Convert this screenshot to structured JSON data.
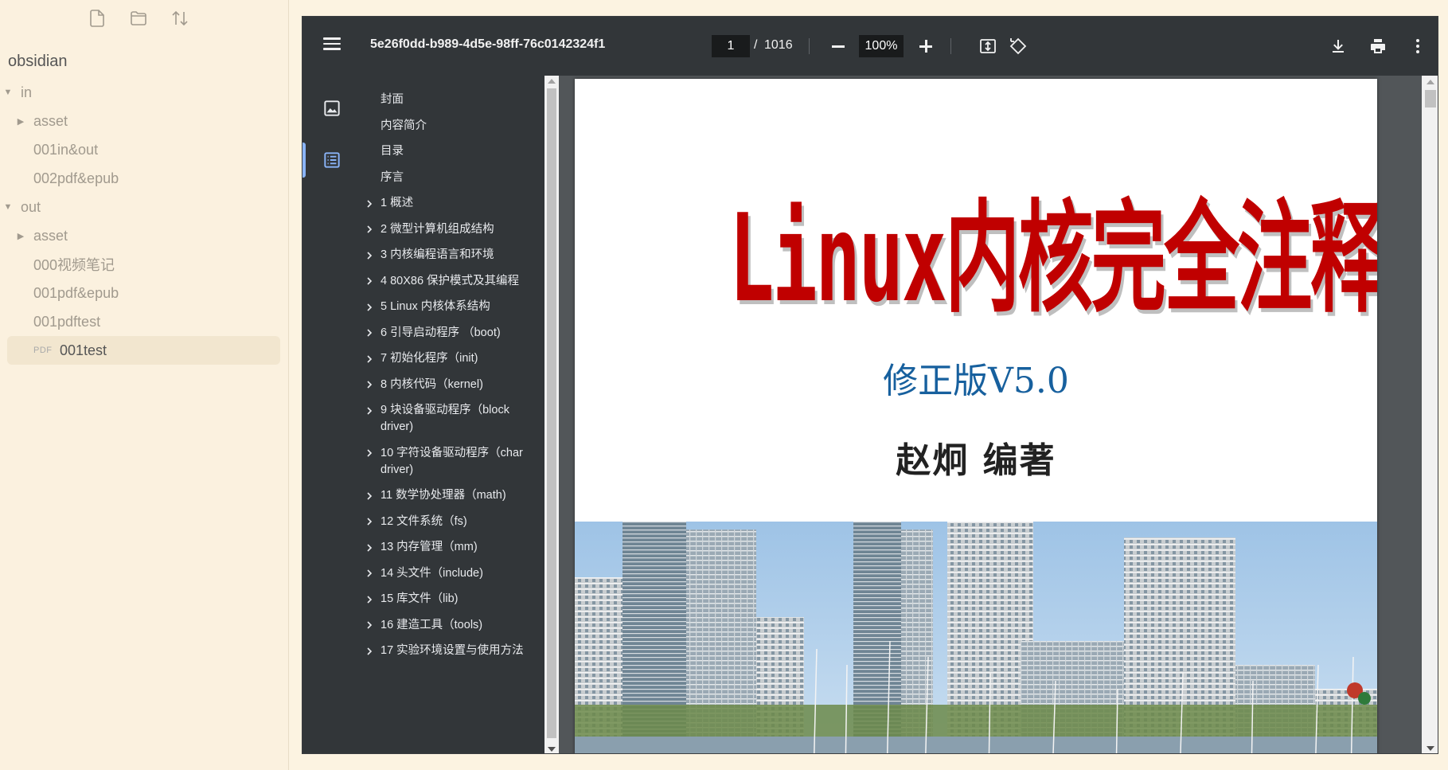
{
  "explorer": {
    "toolbar": [
      "new-note-icon",
      "new-folder-icon",
      "sort-icon"
    ],
    "vault_name": "obsidian",
    "tree": [
      {
        "label": "in",
        "level": 0,
        "type": "folder",
        "expanded": true
      },
      {
        "label": "asset",
        "level": 1,
        "type": "folder",
        "expanded": false
      },
      {
        "label": "001in&out",
        "level": 1,
        "type": "file"
      },
      {
        "label": "002pdf&epub",
        "level": 1,
        "type": "file"
      },
      {
        "label": "out",
        "level": 0,
        "type": "folder",
        "expanded": true
      },
      {
        "label": "asset",
        "level": 1,
        "type": "folder",
        "expanded": false
      },
      {
        "label": "000视频笔记",
        "level": 1,
        "type": "file"
      },
      {
        "label": "001pdf&epub",
        "level": 1,
        "type": "file"
      },
      {
        "label": "001pdftest",
        "level": 1,
        "type": "file"
      },
      {
        "label": "001test",
        "level": 1,
        "type": "pdf",
        "tag": "PDF",
        "selected": true
      }
    ]
  },
  "viewer": {
    "title": "5e26f0dd-b989-4d5e-98ff-76c0142324f1",
    "page_current": "1",
    "page_sep": "/",
    "page_total": "1016",
    "zoom": "100%",
    "outline": [
      {
        "label": "封面",
        "expandable": false
      },
      {
        "label": "内容简介",
        "expandable": false
      },
      {
        "label": "目录",
        "expandable": false
      },
      {
        "label": "序言",
        "expandable": false
      },
      {
        "label": "1 概述",
        "expandable": true
      },
      {
        "label": "2 微型计算机组成结构",
        "expandable": true
      },
      {
        "label": "3 内核编程语言和环境",
        "expandable": true
      },
      {
        "label": "4 80X86 保护模式及其编程",
        "expandable": true
      },
      {
        "label": "5 Linux 内核体系结构",
        "expandable": true
      },
      {
        "label": "6 引导启动程序 （boot)",
        "expandable": true
      },
      {
        "label": "7 初始化程序（init)",
        "expandable": true
      },
      {
        "label": "8 内核代码（kernel)",
        "expandable": true
      },
      {
        "label": "9 块设备驱动程序（block driver)",
        "expandable": true
      },
      {
        "label": "10 字符设备驱动程序（char driver)",
        "expandable": true
      },
      {
        "label": "11 数学协处理器（math)",
        "expandable": true
      },
      {
        "label": "12 文件系统（fs)",
        "expandable": true
      },
      {
        "label": "13 内存管理（mm)",
        "expandable": true
      },
      {
        "label": "14 头文件（include)",
        "expandable": true
      },
      {
        "label": "15 库文件（lib)",
        "expandable": true
      },
      {
        "label": "16 建造工具（tools)",
        "expandable": true
      },
      {
        "label": "17 实验环境设置与使用方法",
        "expandable": true
      }
    ],
    "page": {
      "title": "Linux内核完全注释",
      "edition": "修正版V5.0",
      "author": "赵炯 编著"
    }
  },
  "colors": {
    "explorer_bg": "#fbf1df",
    "toolbar_bg": "#323639",
    "page_area_bg": "#525659",
    "title_red": "#c00000",
    "edition_blue": "#17609e",
    "active_accent": "#8ab4f8"
  }
}
